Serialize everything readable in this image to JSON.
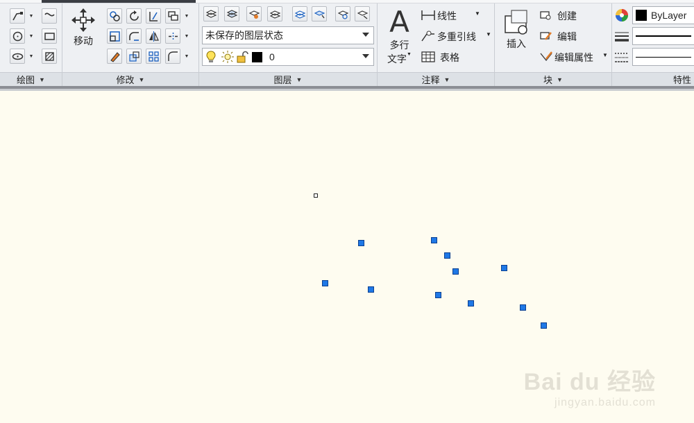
{
  "ribbon": {
    "panels": {
      "draw": {
        "title": "绘图"
      },
      "modify": {
        "title": "修改",
        "move_label": "移动"
      },
      "layers": {
        "title": "图层",
        "layer_state": "未保存的图层状态",
        "current_layer": "0"
      },
      "annotation": {
        "title": "注释",
        "mtext_line1": "多行",
        "mtext_line2": "文字",
        "linear": "线性",
        "multileader": "多重引线",
        "table": "表格"
      },
      "block": {
        "title": "块",
        "insert": "插入",
        "create": "创建",
        "edit": "编辑",
        "edit_attributes": "编辑属性"
      },
      "properties": {
        "title": "特性",
        "color": "ByLayer"
      }
    }
  },
  "colors": {
    "grip": "#1f78e6",
    "canvas_bg": "#fefcf0",
    "ribbon_bg": "#eef0f3"
  },
  "watermark": {
    "line1": "Bai du 经验",
    "line2": "jingyan.baidu.com"
  }
}
